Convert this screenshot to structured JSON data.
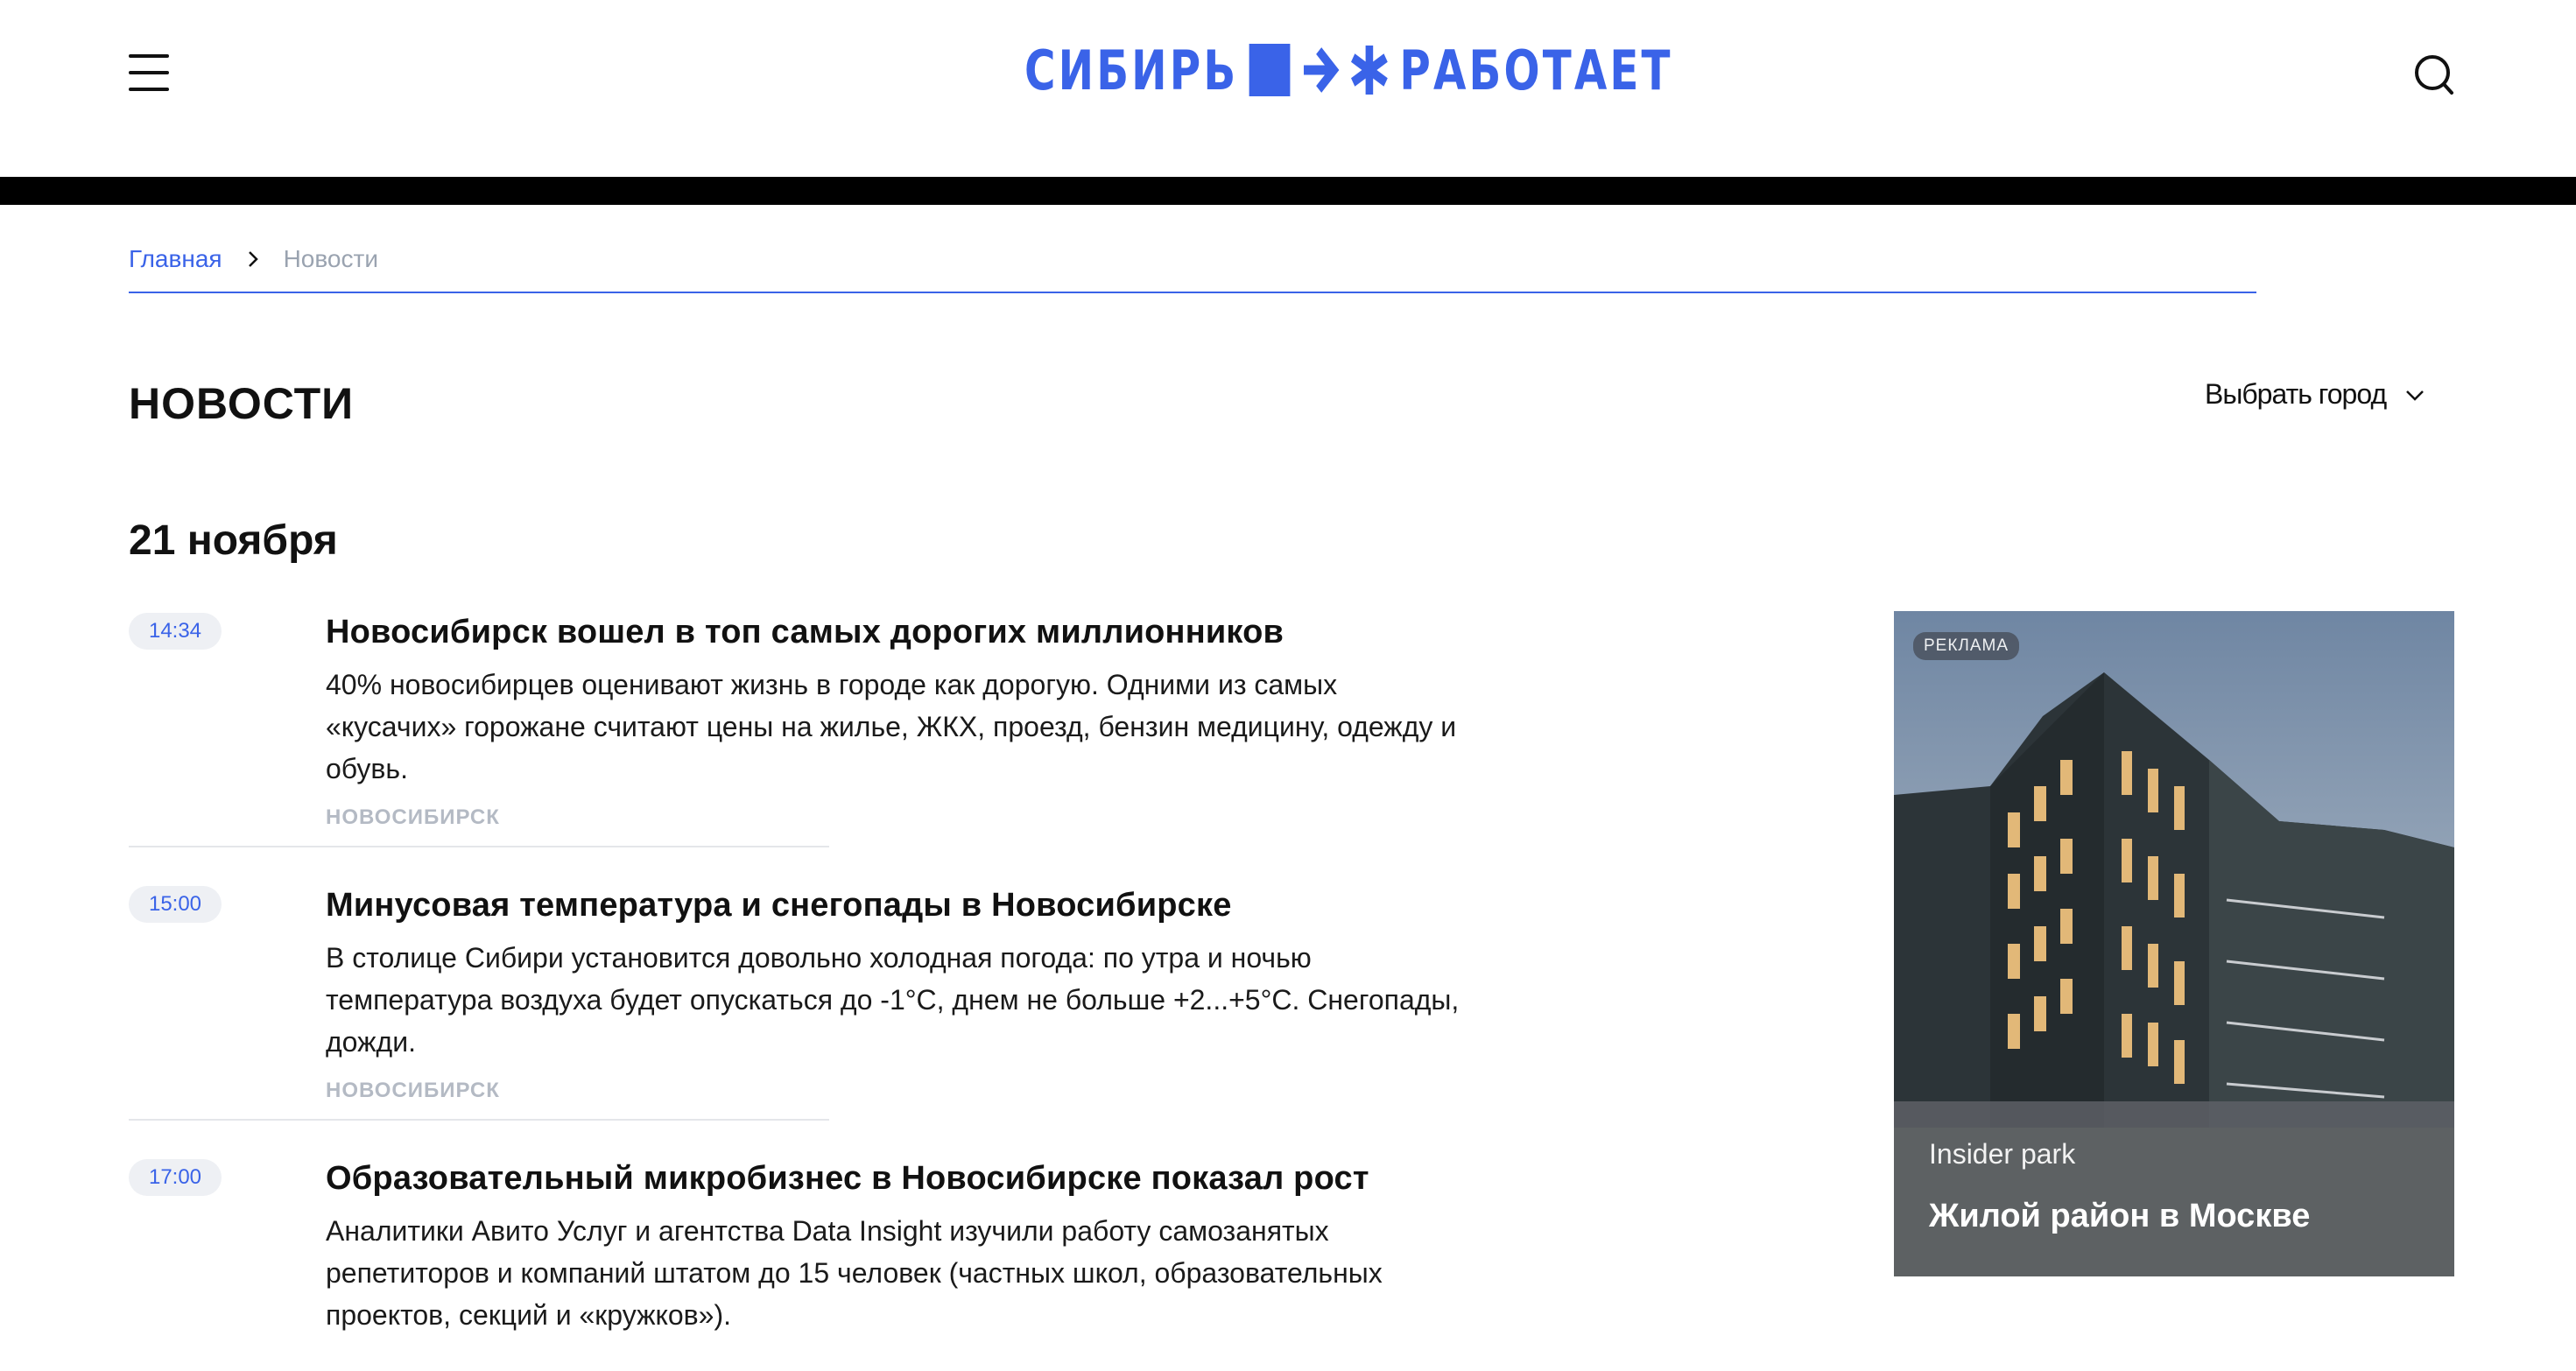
{
  "header": {
    "logo_left": "СИБИРЬ",
    "logo_right": "РАБОТАЕТ"
  },
  "breadcrumb": {
    "home": "Главная",
    "current": "Новости"
  },
  "page": {
    "title": "НОВОСТИ",
    "city_select": "Выбрать город",
    "date_heading": "21 ноября"
  },
  "news": [
    {
      "time": "14:34",
      "headline": "Новосибирск вошел в топ самых дорогих миллионников",
      "summary": "40% новосибирцев оценивают жизнь в городе как дорогую. Одними из самых «кусачих» горожане считают цены на жилье, ЖКХ, проезд, бензин медицину, одежду и обувь.",
      "city": "НОВОСИБИРСК"
    },
    {
      "time": "15:00",
      "headline": "Минусовая температура и снегопады в Новосибирске",
      "summary": "В столице Сибири установится довольно холодная погода: по утра и ночью температура воздуха будет опускаться до -1°С, днем не больше +2...+5°С. Снегопады, дожди.",
      "city": "НОВОСИБИРСК"
    },
    {
      "time": "17:00",
      "headline": "Образовательный микробизнес в Новосибирске показал рост",
      "summary": "Аналитики Авито Услуг и агентства Data Insight изучили работу самозанятых репетиторов и компаний штатом до 15 человек (частных школ, образовательных проектов, секций и «кружков»)."
    }
  ],
  "ad": {
    "badge": "РЕКЛАМА",
    "brand": "Insider park",
    "caption": "Жилой район в Москве"
  },
  "colors": {
    "accent": "#3a63e8",
    "text": "#111111",
    "muted": "#b4bac4",
    "pill_bg": "#eef0f4"
  },
  "icons": [
    "menu-icon",
    "chevron-right-icon",
    "chevron-down-icon",
    "search-icon"
  ]
}
